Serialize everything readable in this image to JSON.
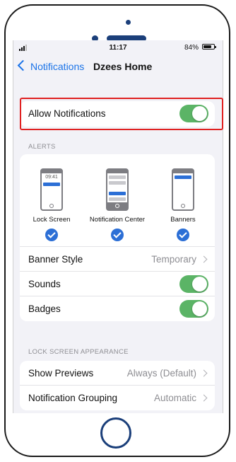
{
  "status": {
    "time": "11:17",
    "battery": "84%"
  },
  "nav": {
    "back_label": "Notifications",
    "title": "Dzees Home"
  },
  "allow": {
    "label": "Allow Notifications",
    "on": true
  },
  "alerts": {
    "header": "ALERTS",
    "styles": [
      {
        "label": "Lock Screen",
        "preview_time": "09:41",
        "checked": true
      },
      {
        "label": "Notification Center",
        "checked": true
      },
      {
        "label": "Banners",
        "checked": true
      }
    ],
    "banner_style": {
      "label": "Banner Style",
      "value": "Temporary"
    },
    "sounds": {
      "label": "Sounds",
      "on": true
    },
    "badges": {
      "label": "Badges",
      "on": true
    }
  },
  "lock_screen": {
    "header": "LOCK SCREEN APPEARANCE",
    "show_previews": {
      "label": "Show Previews",
      "value": "Always (Default)"
    },
    "grouping": {
      "label": "Notification Grouping",
      "value": "Automatic"
    }
  },
  "colors": {
    "accent": "#1a73e8",
    "toggle_on": "#5bb466",
    "highlight": "#e02020",
    "device": "#1b3f7a"
  }
}
